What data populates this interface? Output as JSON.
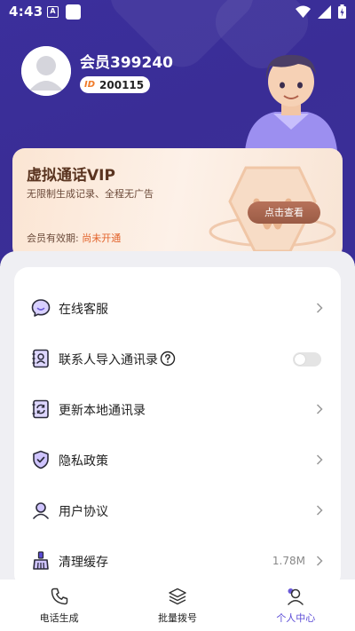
{
  "status_bar": {
    "time": "4:43",
    "notification_glyph": "A"
  },
  "profile": {
    "username": "会员399240",
    "id_tag": "ID",
    "id_number": "200115"
  },
  "vip_card": {
    "title": "虚拟通话VIP",
    "subtitle": "无限制生成记录、全程无广告",
    "validity_label": "会员有效期:",
    "validity_status": "尚未开通",
    "button_label": "点击查看"
  },
  "menu": {
    "items": [
      {
        "label": "在线客服",
        "icon": "chat-bubble-icon",
        "trailing": "chevron"
      },
      {
        "label": "联系人导入通讯录",
        "icon": "contact-book-icon",
        "trailing": "toggle",
        "toggle_on": false
      },
      {
        "label": "更新本地通讯录",
        "icon": "sync-contacts-icon",
        "trailing": "chevron"
      },
      {
        "label": "隐私政策",
        "icon": "shield-check-icon",
        "trailing": "chevron"
      },
      {
        "label": "用户协议",
        "icon": "user-icon",
        "trailing": "chevron"
      },
      {
        "label": "清理缓存",
        "icon": "broom-icon",
        "trailing": "chevron",
        "value": "1.78M"
      }
    ]
  },
  "bottom_nav": {
    "items": [
      {
        "label": "电话生成",
        "icon": "phone-icon"
      },
      {
        "label": "批量拨号",
        "icon": "layers-icon"
      },
      {
        "label": "个人中心",
        "icon": "profile-icon",
        "active": true
      }
    ]
  },
  "colors": {
    "header_bg": "#3a2f98",
    "accent": "#5b4bd6",
    "vip_button": "#a5654e",
    "vip_status": "#e2622a",
    "id_tag": "#f07a28"
  }
}
